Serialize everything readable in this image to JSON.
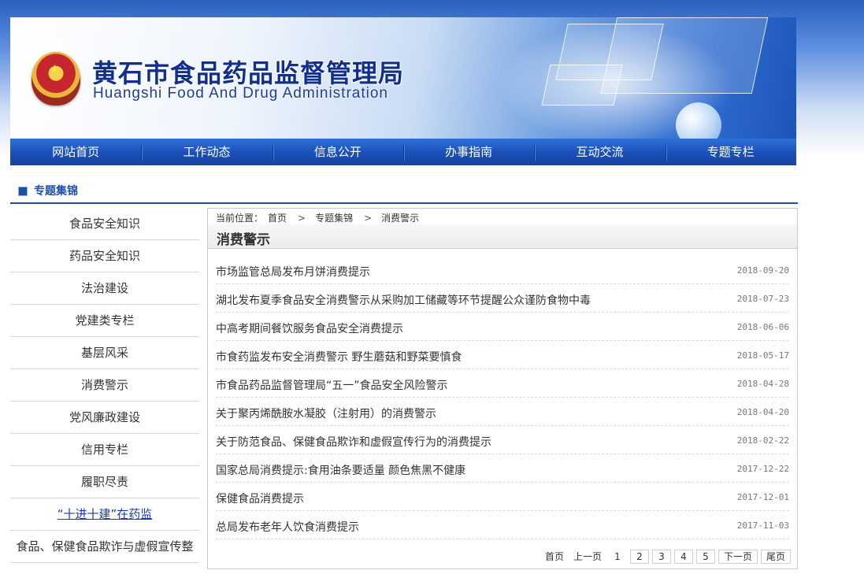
{
  "header": {
    "title_cn": "黄石市食品药品监督管理局",
    "title_en": "Huangshi Food And Drug Administration"
  },
  "nav": {
    "items": [
      "网站首页",
      "工作动态",
      "信息公开",
      "办事指南",
      "互动交流",
      "专题专栏"
    ]
  },
  "section": {
    "title": "专题集锦"
  },
  "sidebar": {
    "items": [
      "食品安全知识",
      "药品安全知识",
      "法治建设",
      "党建类专栏",
      "基层风采",
      "消费警示",
      "党风廉政建设",
      "信用专栏",
      "履职尽责",
      "“十进十建”在药监",
      "食品、保健食品欺诈与虚假宣传整"
    ]
  },
  "breadcrumb": {
    "prefix": "当前位置：",
    "home": "首页",
    "sep": ">",
    "section": "专题集锦",
    "current": "消费警示"
  },
  "content": {
    "title": "消费警示",
    "articles": [
      {
        "title": "市场监管总局发布月饼消费提示",
        "date": "2018-09-20"
      },
      {
        "title": "湖北发布夏季食品安全消费警示从采购加工储藏等环节提醒公众谨防食物中毒",
        "date": "2018-07-23"
      },
      {
        "title": "中高考期间餐饮服务食品安全消费提示",
        "date": "2018-06-06"
      },
      {
        "title": "市食药监发布安全消费警示 野生蘑菇和野菜要慎食",
        "date": "2018-05-17"
      },
      {
        "title": "市食品药品监督管理局“五一”食品安全风险警示",
        "date": "2018-04-28"
      },
      {
        "title": "关于聚丙烯酰胺水凝胶（注射用）的消费警示",
        "date": "2018-04-20"
      },
      {
        "title": "关于防范食品、保健食品欺诈和虚假宣传行为的消费提示",
        "date": "2018-02-22"
      },
      {
        "title": "国家总局消费提示:食用油条要适量 颜色焦黑不健康",
        "date": "2017-12-22"
      },
      {
        "title": "保健食品消费提示",
        "date": "2017-12-01"
      },
      {
        "title": "总局发布老年人饮食消费提示",
        "date": "2017-11-03"
      }
    ]
  },
  "pager": {
    "first": "首页",
    "prev": "上一页",
    "pages": [
      "1",
      "2",
      "3",
      "4",
      "5"
    ],
    "current": "1",
    "next": "下一页",
    "last": "尾页"
  }
}
